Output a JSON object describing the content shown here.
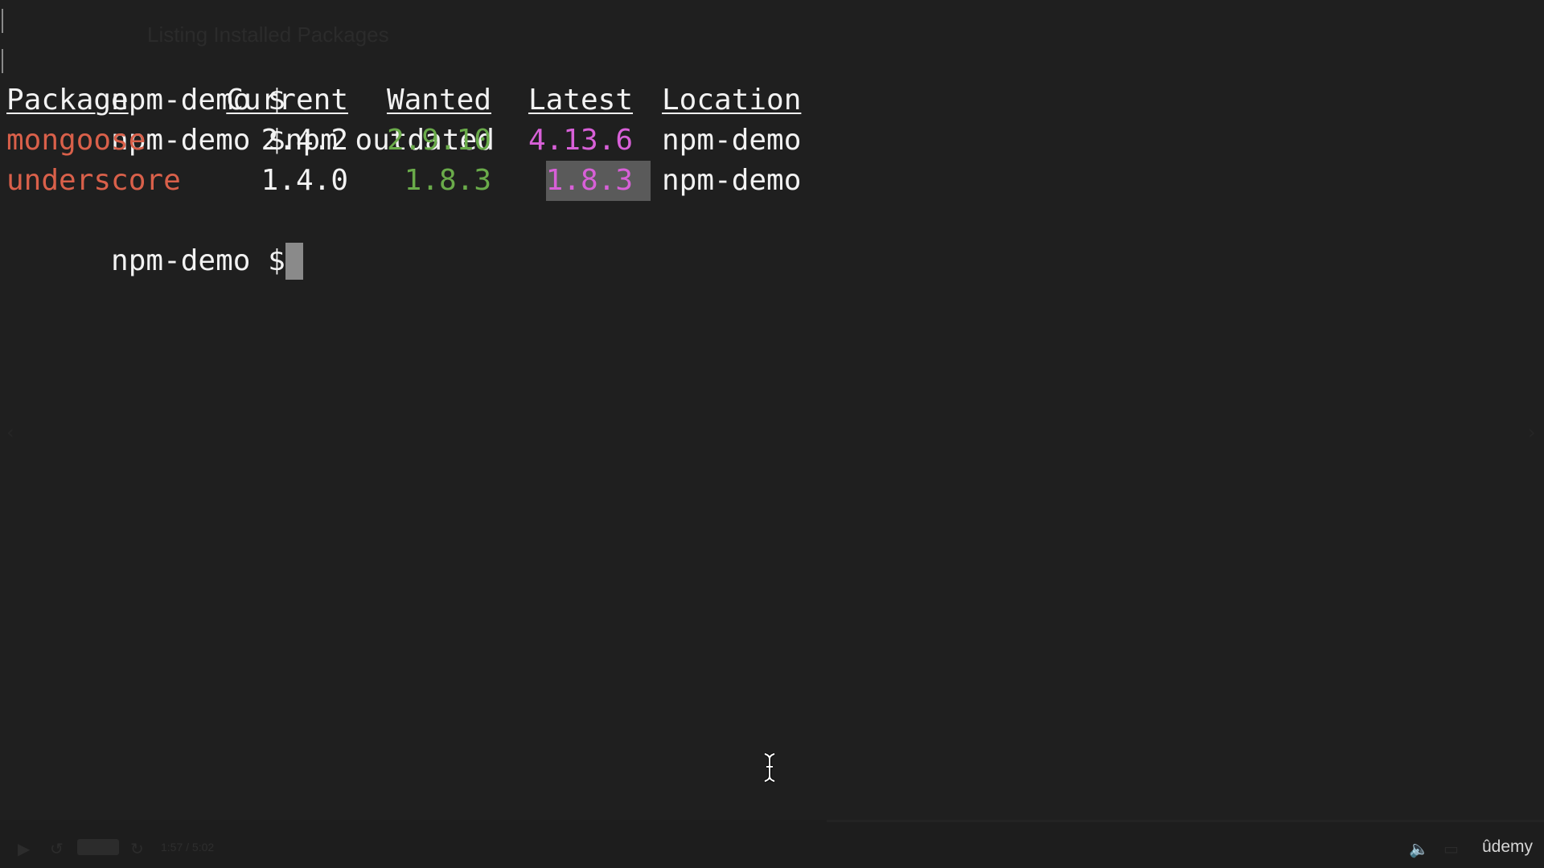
{
  "background_title": "Listing Installed Packages",
  "terminal": {
    "prompt_1": "npm-demo $",
    "command_line": "npm-demo $npm outdated",
    "headers": {
      "package": "Package",
      "current": "Current",
      "wanted": "Wanted",
      "latest": "Latest",
      "location": "Location"
    },
    "rows": [
      {
        "package": "mongoose",
        "current": "2.4.2",
        "wanted": "2.9.10",
        "latest": "4.13.6",
        "location": "npm-demo"
      },
      {
        "package": "underscore",
        "current": "1.4.0",
        "wanted": "1.8.3",
        "latest": "1.8.3",
        "location": "npm-demo"
      }
    ],
    "prompt_final": "npm-demo $"
  },
  "player": {
    "time": "1:57 / 5:02",
    "play_icon": "play-icon",
    "rewind_icon": "rewind-icon",
    "forward_icon": "forward-icon",
    "volume_icon": "volume-icon",
    "captions_icon": "captions-icon",
    "brand": "ûdemy"
  },
  "colors": {
    "background": "#1f1f1f",
    "package_name": "#d9604a",
    "wanted": "#6aab4a",
    "latest": "#d860d8",
    "text": "#f2f2f2",
    "selection": "#5a5a5a"
  }
}
